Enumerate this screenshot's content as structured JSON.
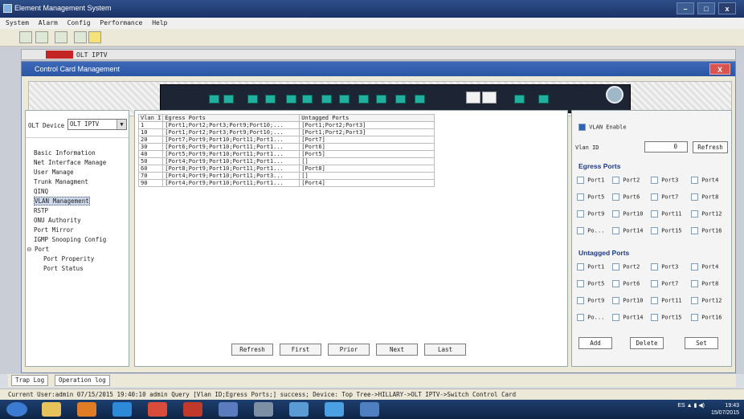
{
  "window": {
    "title": "Element Management System"
  },
  "menu": [
    "System",
    "Alarm",
    "Config",
    "Performance",
    "Help"
  ],
  "tree_node": {
    "label": "OLT IPTV"
  },
  "dialog": {
    "title": "Control Card Management"
  },
  "left": {
    "device_label": "OLT Device",
    "device_value": "OLT IPTV",
    "items": [
      "Basic Information",
      "Net Interface Manage",
      "User Manage",
      "Trunk Managment",
      "QINQ",
      "VLAN Management",
      "RSTP",
      "ONU Authority",
      "Port Mirror",
      "IGMP Snooping Config",
      "Port",
      "Port Properity",
      "Port Status"
    ]
  },
  "table": {
    "headers": [
      "Vlan I",
      "Egress Ports",
      "Untagged Ports"
    ],
    "rows": [
      [
        "1",
        "[Port1;Port2;Port3;Port9;Port10;...",
        "[Port1;Port2;Port3]"
      ],
      [
        "10",
        "[Port1;Port2;Port3;Port9;Port10;...",
        "[Port1;Port2;Port3]"
      ],
      [
        "20",
        "[Port7;Port9;Port10;Port11;Port1...",
        "[Port7]"
      ],
      [
        "30",
        "[Port6;Port9;Port10;Port11;Port1...",
        "[Port6]"
      ],
      [
        "40",
        "[Port5;Port9;Port10;Port11;Port1...",
        "[Port5]"
      ],
      [
        "50",
        "[Port4;Port9;Port10;Port11;Port1...",
        "[]"
      ],
      [
        "60",
        "[Port8;Port9;Port10;Port11;Port1...",
        "[Port8]"
      ],
      [
        "70",
        "[Port4;Port9;Port10;Port11;Port3...",
        "[]"
      ],
      [
        "90",
        "[Port4;Port9;Port10;Port11;Port1...",
        "[Port4]"
      ]
    ],
    "nav": [
      "Refresh",
      "First",
      "Prior",
      "Next",
      "Last"
    ]
  },
  "right": {
    "vlan_enable": "VLAN Enable",
    "vlan_id_label": "Vlan ID",
    "vlan_id_value": "0",
    "refresh": "Refresh",
    "egress_title": "Egress Ports",
    "untagged_title": "Untagged Ports",
    "egress_ports": [
      "Port1",
      "Port2",
      "Port3",
      "Port4",
      "Port5",
      "Port6",
      "Port7",
      "Port8",
      "Port9",
      "Port10",
      "Port11",
      "Port12",
      "Po...",
      "Port14",
      "Port15",
      "Port16"
    ],
    "untagged_ports": [
      "Port1",
      "Port2",
      "Port3",
      "Port4",
      "Port5",
      "Port6",
      "Port7",
      "Port8",
      "Port9",
      "Port10",
      "Port11",
      "Port12",
      "Po...",
      "Port14",
      "Port15",
      "Port16"
    ],
    "add": "Add",
    "delete": "Delete",
    "set": "Set"
  },
  "bottom_tabs": [
    "Trap Log",
    "Operation log"
  ],
  "status": "Current User:admin   07/15/2015 19:40:10  admin  Query [Vlan ID;Egress Ports;] success; Device: Top Tree->HILLARY->OLT IPTV->Switch Control Card",
  "tray": {
    "lang": "ES",
    "time": "19:43",
    "date": "15/07/2015"
  }
}
